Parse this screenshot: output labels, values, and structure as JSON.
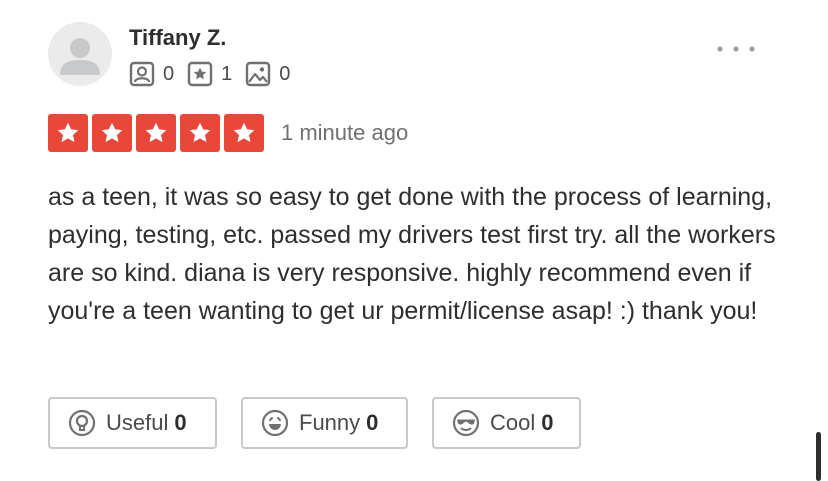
{
  "review": {
    "user": {
      "name": "Tiffany Z.",
      "avatar_icon": "default-user-silhouette-icon",
      "stats": {
        "friends": "0",
        "reviews": "1",
        "photos": "0"
      }
    },
    "rating": 5,
    "rating_max": 5,
    "time_ago": "1 minute ago",
    "text": "as a teen, it was so easy to get done with the process of learning, paying, testing, etc. passed my drivers test first try. all the workers are so kind. diana is very responsive. highly recommend even if you're a teen wanting to get ur permit/license asap! :) thank you!",
    "reactions": {
      "useful": {
        "label": "Useful",
        "count": "0"
      },
      "funny": {
        "label": "Funny",
        "count": "0"
      },
      "cool": {
        "label": "Cool",
        "count": "0"
      }
    }
  },
  "colors": {
    "star_red": "#e8473a",
    "text_dark": "#2d2e2f",
    "text_muted": "#6e7072",
    "border_gray": "#c9c9c9",
    "icon_gray": "#6e7072"
  }
}
